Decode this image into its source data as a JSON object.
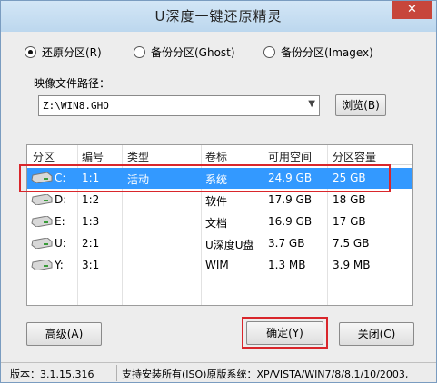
{
  "window": {
    "title": "U深度一键还原精灵",
    "close_label": "✕"
  },
  "mode_options": [
    {
      "label": "还原分区(R)",
      "selected": true
    },
    {
      "label": "备份分区(Ghost)",
      "selected": false
    },
    {
      "label": "备份分区(Imagex)",
      "selected": false
    }
  ],
  "image_path": {
    "label": "映像文件路径：",
    "value": "Z:\\WIN8.GHO",
    "browse_label": "浏览(B)"
  },
  "partition_table": {
    "headers": [
      "分区",
      "编号",
      "类型",
      "卷标",
      "可用空间",
      "分区容量"
    ],
    "rows": [
      {
        "drive": "C:",
        "number": "1:1",
        "type": "活动",
        "label": "系统",
        "free": "24.9 GB",
        "size": "25 GB",
        "selected": true
      },
      {
        "drive": "D:",
        "number": "1:2",
        "type": "",
        "label": "软件",
        "free": "17.9 GB",
        "size": "18 GB",
        "selected": false
      },
      {
        "drive": "E:",
        "number": "1:3",
        "type": "",
        "label": "文档",
        "free": "16.9 GB",
        "size": "17 GB",
        "selected": false
      },
      {
        "drive": "U:",
        "number": "2:1",
        "type": "",
        "label": "U深度U盘",
        "free": "3.7 GB",
        "size": "7.5 GB",
        "selected": false
      },
      {
        "drive": "Y:",
        "number": "3:1",
        "type": "",
        "label": "WIM",
        "free": "1.3 MB",
        "size": "3.9 MB",
        "selected": false
      }
    ]
  },
  "buttons": {
    "advanced": "高级(A)",
    "ok": "确定(Y)",
    "close": "关闭(C)"
  },
  "status": {
    "version": "版本：3.1.15.316",
    "support": "支持安装所有(ISO)原版系统：XP/VISTA/WIN7/8/8.1/10/2003,"
  }
}
